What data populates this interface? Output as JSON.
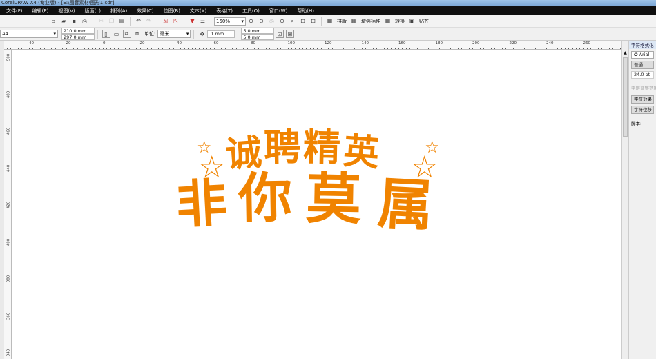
{
  "window": {
    "title": "CorelDRAW X4 (专业版) - [E:\\图音素材\\图形1.cdr]"
  },
  "menu": [
    "文件(F)",
    "编辑(E)",
    "视图(V)",
    "版面(L)",
    "排列(A)",
    "效果(C)",
    "位图(B)",
    "文本(X)",
    "表格(T)",
    "工具(O)",
    "窗口(W)",
    "帮助(H)"
  ],
  "toolbar": {
    "zoom": "150%",
    "plugins": [
      {
        "label": "排版",
        "icon": "layout-icon"
      },
      {
        "label": "增强插件",
        "icon": "plugin-icon"
      },
      {
        "label": "转换",
        "icon": "convert-icon"
      },
      {
        "label": "贴齐",
        "icon": "snap-icon"
      }
    ]
  },
  "propertybar": {
    "page_size": "A4",
    "width": "210.0 mm",
    "height": "297.0 mm",
    "units_label": "单位:",
    "units": "毫米",
    "nudge": ".1 mm",
    "dup_x": "5.0 mm",
    "dup_y": "5.0 mm"
  },
  "ruler": {
    "top": [
      "40",
      "20",
      "0",
      "20",
      "40",
      "60",
      "80",
      "100",
      "120",
      "140",
      "160",
      "180",
      "200",
      "220",
      "240",
      "260"
    ],
    "left": [
      "500",
      "480",
      "460",
      "440",
      "420",
      "400",
      "380",
      "360",
      "340"
    ]
  },
  "artwork": {
    "line1": [
      "诚",
      "聘",
      "精",
      "英"
    ],
    "line2": [
      "非",
      "你",
      "莫",
      "属"
    ],
    "color": "#f08300"
  },
  "docker": {
    "title": "字符格式化",
    "font": "Arial",
    "style": "普通",
    "size": "24.0 pt",
    "range_label": "字距调整范围",
    "effects": "字符效果",
    "shift": "字符位移",
    "script": "脚本:"
  }
}
